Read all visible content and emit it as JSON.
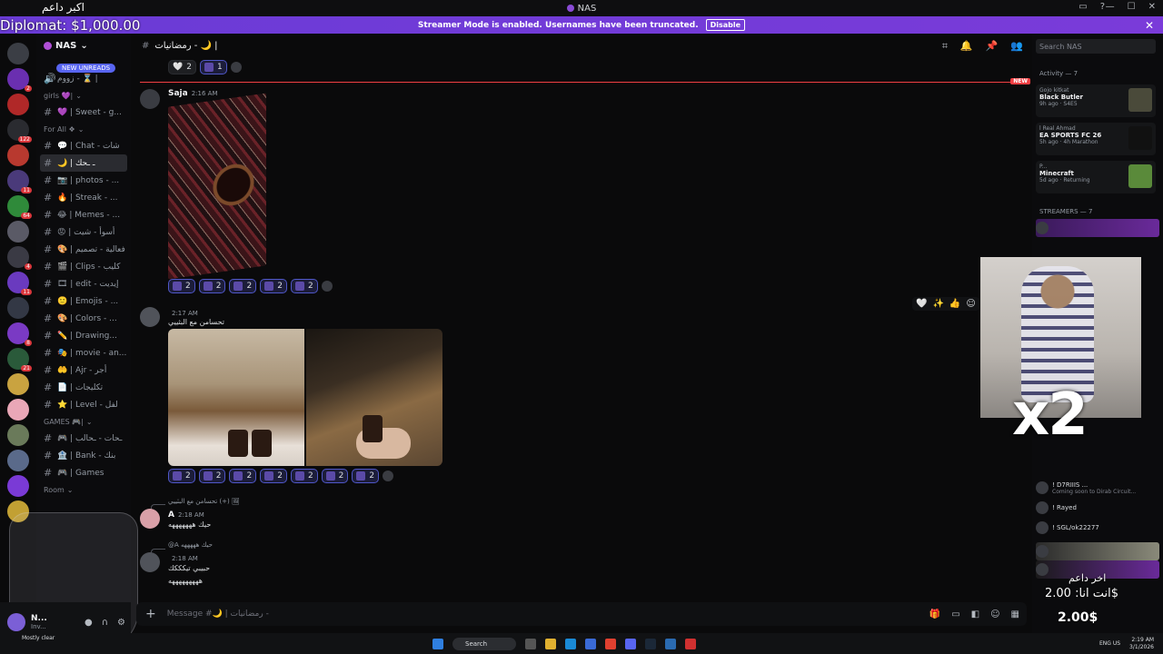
{
  "window": {
    "title": "NAS"
  },
  "overlay": {
    "title_ar": "اكبر داعم",
    "diplomat": "Diplomat: $1,000.00",
    "donor_ar": "اخر داعم",
    "anta_ar": "انت انا: 2.00$",
    "amount": "2.00$",
    "x2": "x2"
  },
  "streamer_bar": {
    "text": "Streamer Mode is enabled. Usernames have been truncated.",
    "button": "Disable"
  },
  "server": {
    "name": "NAS",
    "new_unreads": "NEW UNREADS"
  },
  "channels": [
    {
      "type": "voice",
      "label": "زووم - ⌛ |"
    },
    {
      "type": "category",
      "label": "girls 💜|"
    },
    {
      "type": "text",
      "label": "💜 | Sweet - g..."
    },
    {
      "type": "category",
      "label": "For All ❖"
    },
    {
      "type": "text",
      "label": "💬 | Chat - شات"
    },
    {
      "type": "text",
      "label": "🌙 | ـ ـحك",
      "active": true
    },
    {
      "type": "text",
      "label": "📷 | photos - ..."
    },
    {
      "type": "text",
      "label": "🔥 | Streak - ..."
    },
    {
      "type": "text",
      "label": "😂 | Memes - ..."
    },
    {
      "type": "text",
      "label": "😡 | أسوأ - شيت"
    },
    {
      "type": "text",
      "label": "🎨 | فعالية - تصميم"
    },
    {
      "type": "text",
      "label": "🎬 | Clips - كليب"
    },
    {
      "type": "text",
      "label": "🎞 | edit - إيديت"
    },
    {
      "type": "text",
      "label": "🙂 | Emojis - ..."
    },
    {
      "type": "text",
      "label": "🎨 | Colors - ..."
    },
    {
      "type": "text",
      "label": "✏️ | Drawing..."
    },
    {
      "type": "text",
      "label": "🎭 | movie - an..."
    },
    {
      "type": "text",
      "label": "🤲 | Ajr - أجر"
    },
    {
      "type": "text",
      "label": "📄 | تكليجات"
    },
    {
      "type": "text",
      "label": "⭐ | Level - لفل"
    },
    {
      "type": "category",
      "label": "GAMES 🎮|"
    },
    {
      "type": "text",
      "label": "🎮 | ـحات - ـحالب"
    },
    {
      "type": "text",
      "label": "🏦 | Bank - بنك"
    },
    {
      "type": "text",
      "label": "🎮 | Games"
    },
    {
      "type": "category",
      "label": "Room"
    }
  ],
  "user_panel": {
    "name": "N...",
    "status": "Inv..."
  },
  "chat": {
    "channel_name": "رمضانيات - 🌙 |",
    "new_tag": "NEW",
    "top_reactions": [
      {
        "emoji": "🤍",
        "count": "2"
      },
      {
        "emoji": "🖼",
        "count": "1"
      }
    ],
    "messages": [
      {
        "author": "Saja",
        "time": "2:16 AM"
      },
      {
        "author": "",
        "time": "2:17 AM",
        "text": "تحسامن مع البثييي"
      },
      {
        "author": "A",
        "time": "2:18 AM",
        "text": "حيك هههههههه",
        "reply": "تحسامن مع البثييي (+) 🖼"
      },
      {
        "author": "",
        "time": "2:18 AM",
        "text": "حبيبي تيكككك",
        "text2": "هههههههههه",
        "reply": "@A حيك هههههه"
      }
    ],
    "reactions_1": [
      "2",
      "2",
      "2",
      "2",
      "2"
    ],
    "reactions_2": [
      "2",
      "2",
      "2",
      "2",
      "2",
      "2",
      "2"
    ],
    "composer_placeholder": "Message #🌙 | رمضانيات -"
  },
  "right_panel": {
    "search_placeholder": "Search NAS",
    "activity_heading": "Activity — 7",
    "activities": [
      {
        "who": "Gojo kitkat",
        "game": "Black Butler",
        "meta": "9h ago · S4E5"
      },
      {
        "who": "l Real Ahmad",
        "game": "EA SPORTS FC 26",
        "meta": "5h ago · 4h Marathon"
      },
      {
        "who": "P...",
        "game": "Minecraft",
        "meta": "5d ago · Returning"
      }
    ],
    "streamers_heading": "STREAMERS — 7",
    "members": [
      {
        "name": "! D7RIIIS ...",
        "sub": "Coming soon to Dirab Circuit..."
      },
      {
        "name": "! Rayed",
        "sub": ""
      },
      {
        "name": "! SGL/ok22277",
        "sub": ""
      }
    ]
  },
  "taskbar": {
    "weather": "Mostly clear",
    "search": "Search",
    "lang": "ENG US",
    "time": "2:19 AM",
    "date": "3/1/2026"
  }
}
